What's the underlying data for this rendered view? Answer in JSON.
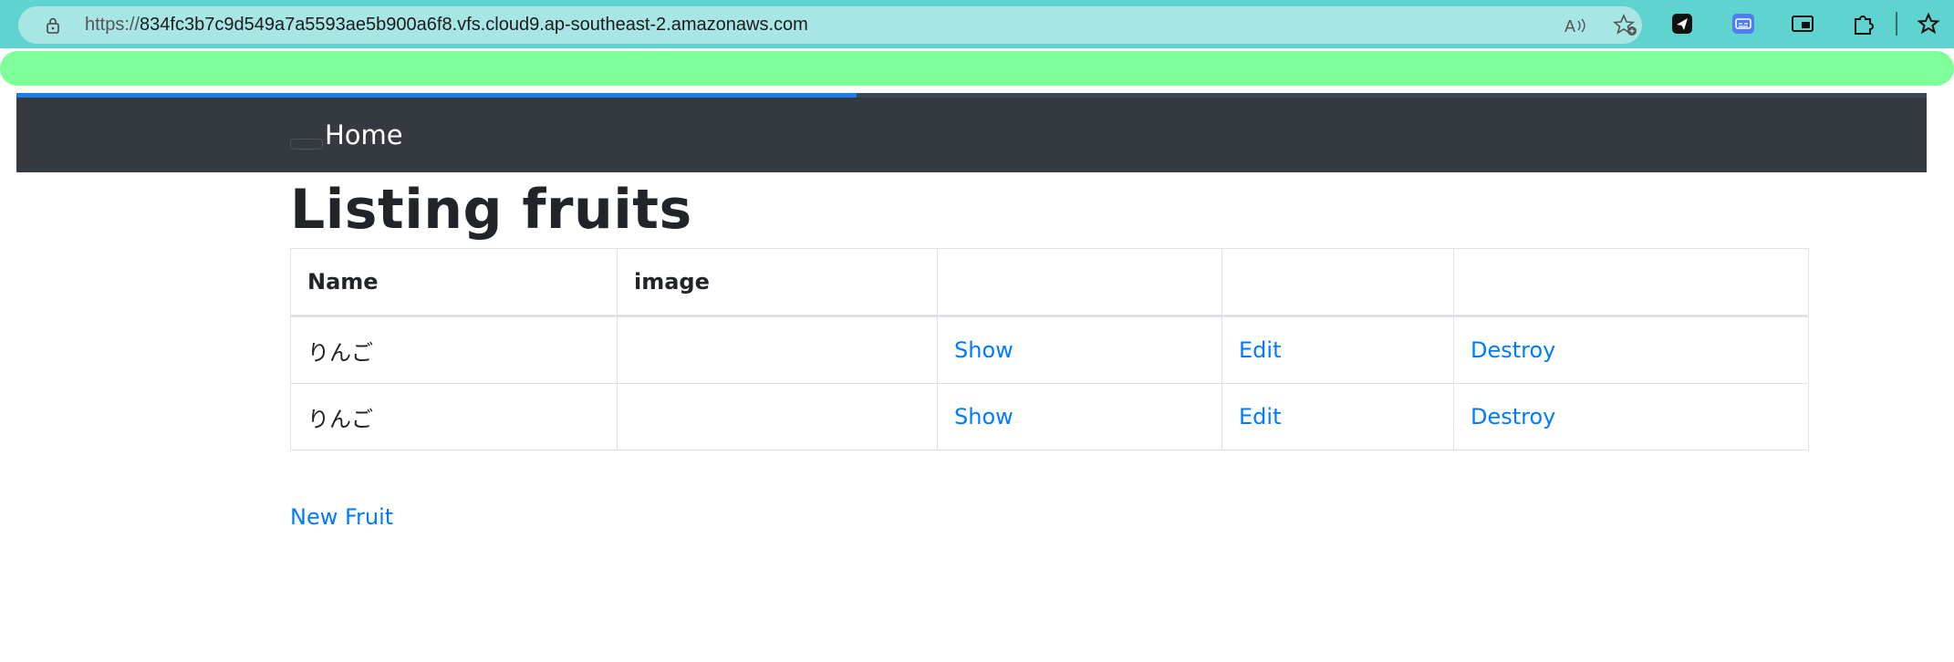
{
  "browser": {
    "url_scheme": "https://",
    "url_host": "834fc3b7c9d549a7a5593ae5b900a6f8.vfs.cloud9.ap-southeast-2.amazonaws.com",
    "progress_fraction": 0.44,
    "icons": [
      "lock-icon",
      "read-aloud-icon",
      "add-favorite-icon",
      "send-extension-icon",
      "subtitle-extension-icon",
      "picture-in-picture-icon",
      "extensions-puzzle-icon",
      "favorites-icon"
    ]
  },
  "navbar": {
    "brand": "Home"
  },
  "main": {
    "title": "Listing fruits",
    "table": {
      "headers": [
        "Name",
        "image",
        "",
        "",
        ""
      ],
      "rows": [
        {
          "name": "りんご",
          "image": "",
          "show": "Show",
          "edit": "Edit",
          "destroy": "Destroy"
        },
        {
          "name": "りんご",
          "image": "",
          "show": "Show",
          "edit": "Edit",
          "destroy": "Destroy"
        }
      ]
    },
    "new_link": "New Fruit"
  },
  "colors": {
    "chrome": "#5fd3d0",
    "address_bar": "#a8e6e6",
    "highlight": "#7fff9a",
    "navbar": "#343a40",
    "link": "#007bff"
  }
}
